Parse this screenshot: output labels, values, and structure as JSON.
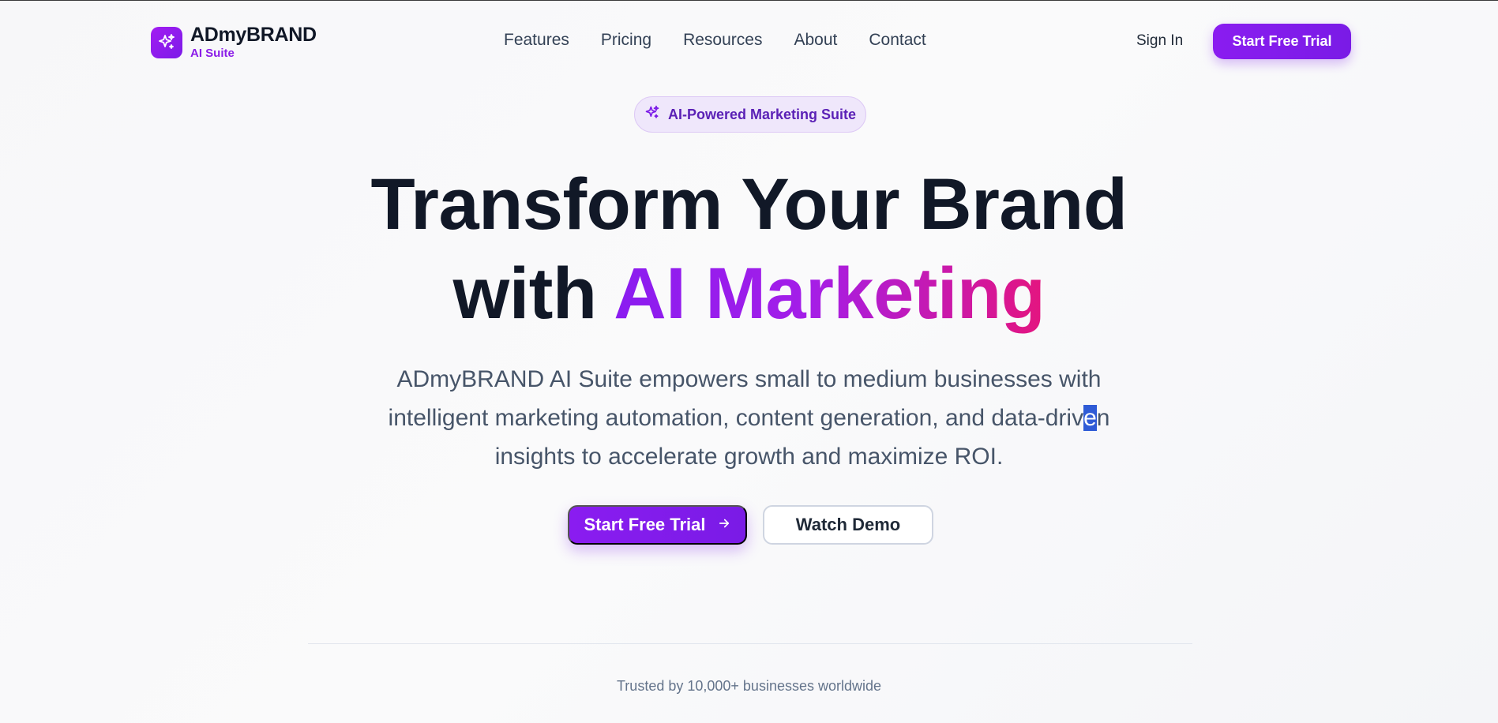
{
  "brand": {
    "name": "ADmyBRAND",
    "subtitle": "AI Suite"
  },
  "nav": {
    "items": [
      "Features",
      "Pricing",
      "Resources",
      "About",
      "Contact"
    ],
    "sign_in": "Sign In",
    "cta": "Start Free Trial"
  },
  "hero": {
    "badge": "AI-Powered Marketing Suite",
    "title_line1": "Transform Your Brand",
    "title_line2_plain": "with",
    "title_line2_gradient": "AI Marketing",
    "subtitle_part1": "ADmyBRAND AI Suite empowers small to medium businesses with intelligent marketing automation, content generation, and data-driv",
    "subtitle_selected": "e",
    "subtitle_part2": "n insights to accelerate growth and maximize ROI.",
    "primary_button": "Start Free Trial",
    "secondary_button": "Watch Demo"
  },
  "trusted": "Trusted by 10,000+ businesses worldwide",
  "colors": {
    "accent": "#8a1cf0",
    "gradient_end": "#e4157f",
    "selection": "#2f5bd6"
  },
  "icons": {
    "logo": "sparkles-icon",
    "badge": "sparkles-icon",
    "primary_button": "arrow-right-icon"
  }
}
